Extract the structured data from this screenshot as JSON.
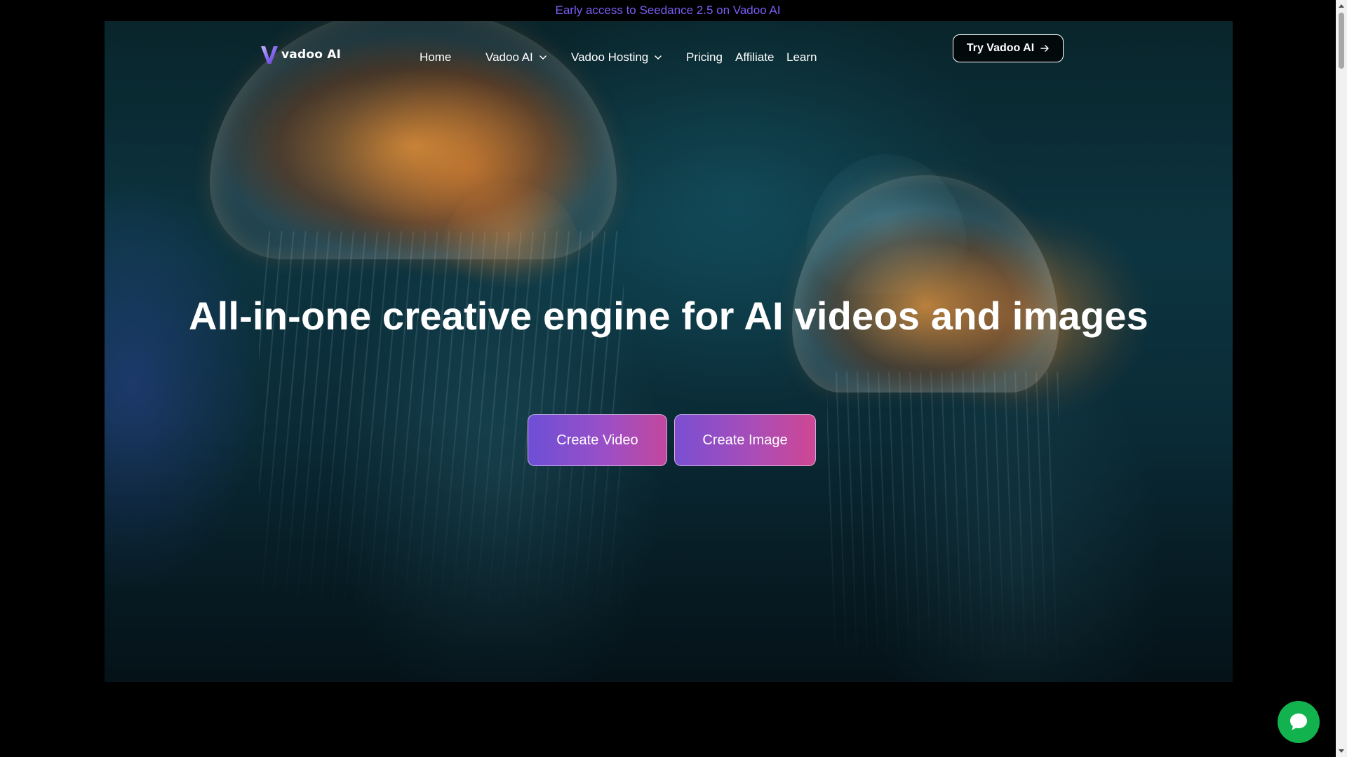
{
  "announcement": {
    "text": "Early access to Seedance 2.5 on Vadoo AI",
    "color": "#7c5cf5"
  },
  "header": {
    "logo_text": "vadoo AI",
    "logo_icon": "v-logo-icon",
    "nav": [
      {
        "label": "Home",
        "has_dropdown": false
      },
      {
        "label": "Vadoo AI",
        "has_dropdown": true
      },
      {
        "label": "Vadoo Hosting",
        "has_dropdown": true
      },
      {
        "label": "Pricing",
        "has_dropdown": false
      },
      {
        "label": "Affiliate",
        "has_dropdown": false
      },
      {
        "label": "Learn",
        "has_dropdown": false
      }
    ],
    "cta_label": "Try Vadoo AI",
    "cta_icon": "arrow-right-icon"
  },
  "hero": {
    "headline": "All-in-one creative engine for AI videos and images",
    "buttons": {
      "create_video": "Create Video",
      "create_image": "Create Image"
    }
  },
  "chat_widget": {
    "icon": "chat-bubble-icon",
    "color": "#12b24f"
  }
}
